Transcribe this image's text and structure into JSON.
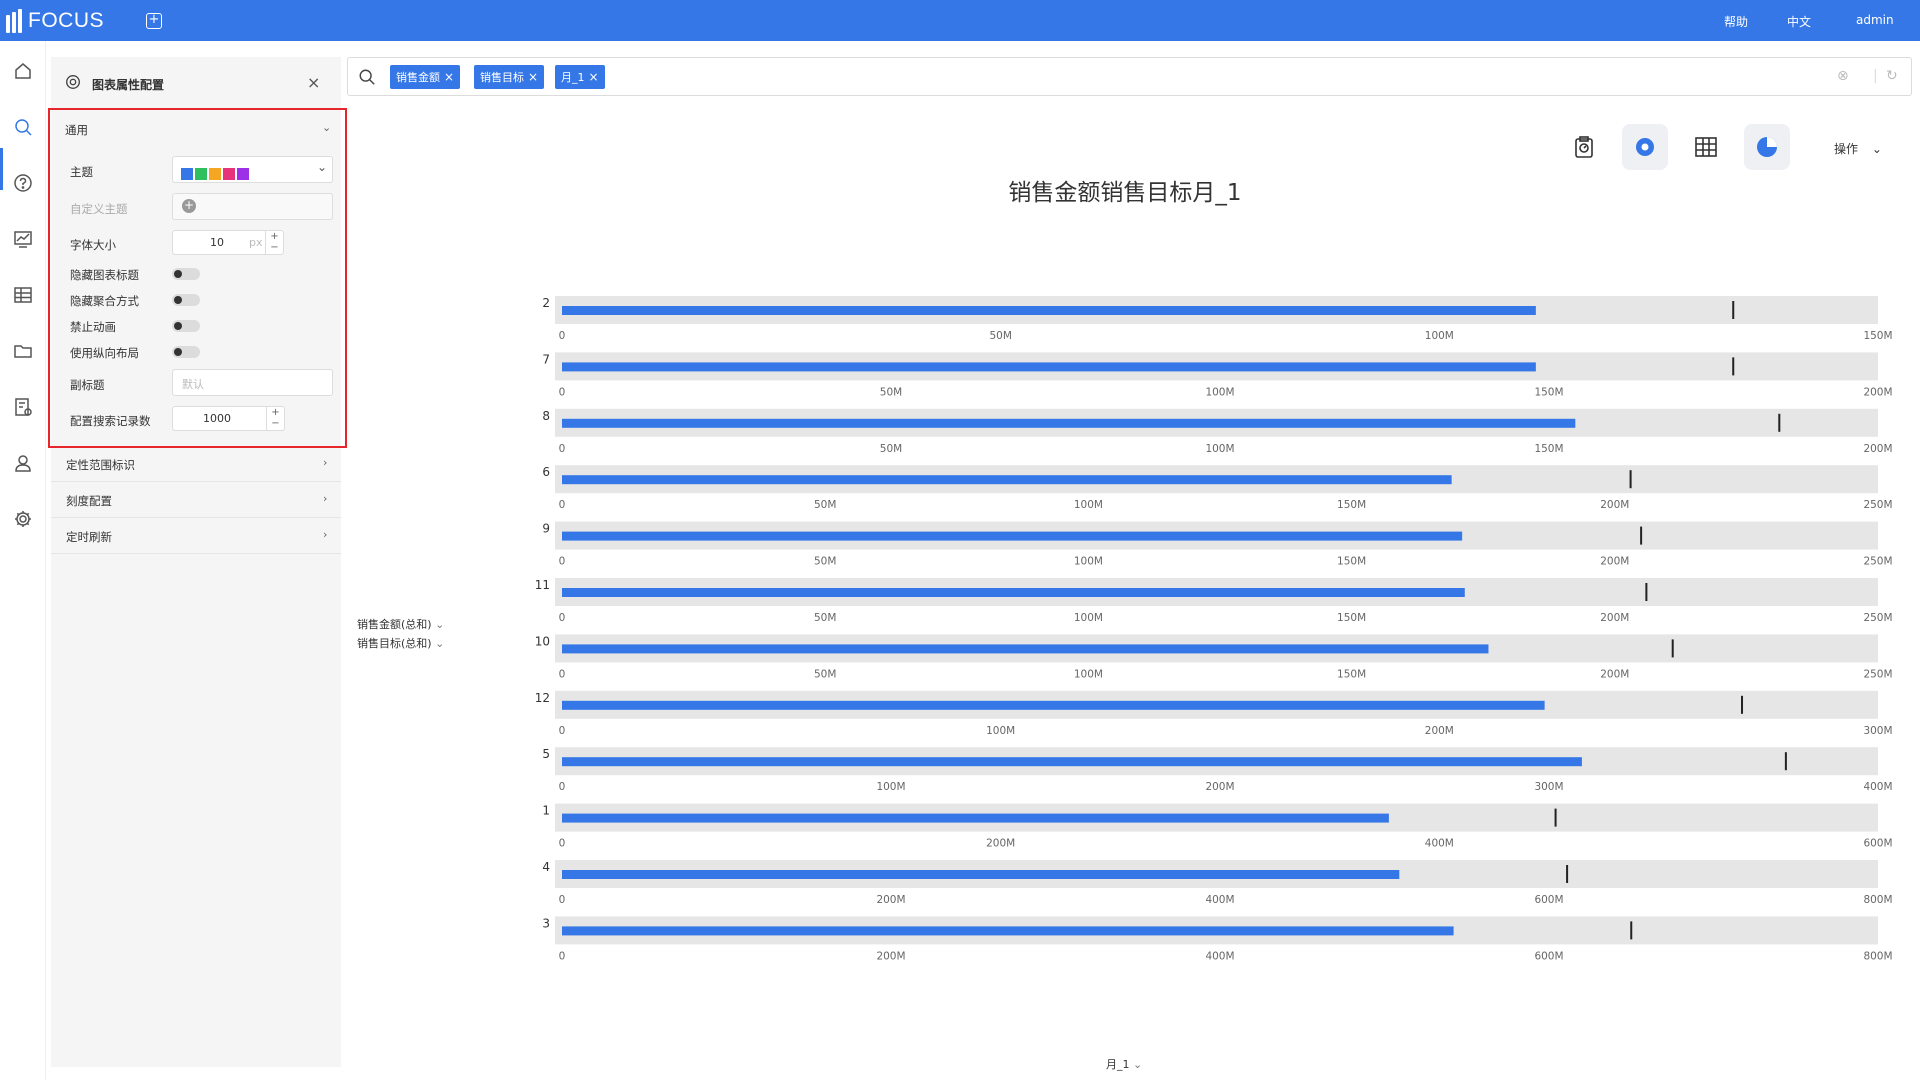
{
  "topbar": {
    "app_name": "FOCUS",
    "help": "帮助",
    "language": "中文",
    "user": "admin"
  },
  "panel": {
    "title": "图表属性配置",
    "general": {
      "title": "通用",
      "theme_label": "主题",
      "theme_colors": [
        "#3577e6",
        "#2ec05f",
        "#f5a623",
        "#e6337a",
        "#9b30e6"
      ],
      "custom_theme_label": "自定义主题",
      "font_size_label": "字体大小",
      "font_size_value": "10",
      "font_size_unit": "px",
      "hide_title_label": "隐藏图表标题",
      "hide_agg_label": "隐藏聚合方式",
      "disable_anim_label": "禁止动画",
      "vertical_layout_label": "使用纵向布局",
      "subtitle_label": "副标题",
      "subtitle_placeholder": "默认",
      "search_records_label": "配置搜索记录数",
      "search_records_value": "1000"
    },
    "sections": [
      "定性范围标识",
      "刻度配置",
      "定时刷新"
    ]
  },
  "search": {
    "tags": [
      "销售金额",
      "销售目标",
      "月_1"
    ]
  },
  "toolbar": {
    "ops_label": "操作"
  },
  "chart_data": {
    "type": "bullet",
    "title": "销售金额销售目标月_1",
    "x_field": "月_1",
    "legend": [
      "销售金额(总和)",
      "销售目标(总和)"
    ],
    "colors": {
      "bar": "#3577e6",
      "track": "#e6e6e6",
      "target": "#222222"
    },
    "rows": [
      {
        "category": "2",
        "value": 111,
        "target": 133.5,
        "max": 150,
        "ticks": [
          0,
          50,
          100,
          150
        ],
        "tick_labels": [
          "0",
          "50M",
          "100M",
          "150M"
        ]
      },
      {
        "category": "7",
        "value": 148,
        "target": 178,
        "max": 200,
        "ticks": [
          0,
          50,
          100,
          150,
          200
        ],
        "tick_labels": [
          "0",
          "50M",
          "100M",
          "150M",
          "200M"
        ]
      },
      {
        "category": "8",
        "value": 154,
        "target": 185,
        "max": 200,
        "ticks": [
          0,
          50,
          100,
          150,
          200
        ],
        "tick_labels": [
          "0",
          "50M",
          "100M",
          "150M",
          "200M"
        ]
      },
      {
        "category": "6",
        "value": 169,
        "target": 203,
        "max": 250,
        "ticks": [
          0,
          50,
          100,
          150,
          200,
          250
        ],
        "tick_labels": [
          "0",
          "50M",
          "100M",
          "150M",
          "200M",
          "250M"
        ]
      },
      {
        "category": "9",
        "value": 171,
        "target": 205,
        "max": 250,
        "ticks": [
          0,
          50,
          100,
          150,
          200,
          250
        ],
        "tick_labels": [
          "0",
          "50M",
          "100M",
          "150M",
          "200M",
          "250M"
        ]
      },
      {
        "category": "11",
        "value": 171.5,
        "target": 206,
        "max": 250,
        "ticks": [
          0,
          50,
          100,
          150,
          200,
          250
        ],
        "tick_labels": [
          "0",
          "50M",
          "100M",
          "150M",
          "200M",
          "250M"
        ]
      },
      {
        "category": "10",
        "value": 176,
        "target": 211,
        "max": 250,
        "ticks": [
          0,
          50,
          100,
          150,
          200,
          250
        ],
        "tick_labels": [
          "0",
          "50M",
          "100M",
          "150M",
          "200M",
          "250M"
        ]
      },
      {
        "category": "12",
        "value": 224,
        "target": 269,
        "max": 300,
        "ticks": [
          0,
          100,
          200,
          300
        ],
        "tick_labels": [
          "0",
          "100M",
          "200M",
          "300M"
        ]
      },
      {
        "category": "5",
        "value": 310,
        "target": 372,
        "max": 400,
        "ticks": [
          0,
          100,
          200,
          300,
          400
        ],
        "tick_labels": [
          "0",
          "100M",
          "200M",
          "300M",
          "400M"
        ]
      },
      {
        "category": "1",
        "value": 377,
        "target": 453,
        "max": 600,
        "ticks": [
          0,
          200,
          400,
          600
        ],
        "tick_labels": [
          "0",
          "200M",
          "400M",
          "600M"
        ]
      },
      {
        "category": "4",
        "value": 509,
        "target": 611,
        "max": 800,
        "ticks": [
          0,
          200,
          400,
          600,
          800
        ],
        "tick_labels": [
          "0",
          "200M",
          "400M",
          "600M",
          "800M"
        ]
      },
      {
        "category": "3",
        "value": 542,
        "target": 650,
        "max": 800,
        "ticks": [
          0,
          200,
          400,
          600,
          800
        ],
        "tick_labels": [
          "0",
          "200M",
          "400M",
          "600M",
          "800M"
        ]
      }
    ]
  }
}
